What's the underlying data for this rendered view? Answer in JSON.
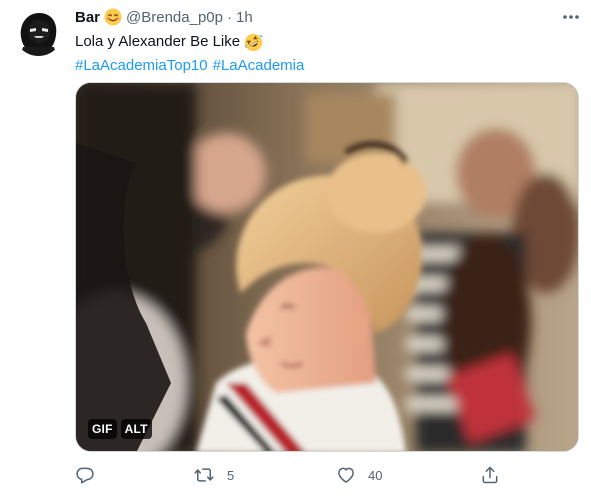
{
  "tweet": {
    "display_name": "Bar",
    "name_emoji": "smiling-face-with-smiling-eyes",
    "handle": "@Brenda_p0p",
    "separator": "·",
    "time": "1h",
    "text": "Lola y Alexander Be Like",
    "text_emoji": "rolling-on-the-floor-laughing",
    "hashtags": [
      "#LaAcademiaTop10",
      "#LaAcademia"
    ],
    "media": {
      "type_badge": "GIF",
      "alt_badge": "ALT"
    },
    "actions": {
      "reply_count": "",
      "retweet_count": "5",
      "like_count": "40",
      "share_count": ""
    }
  },
  "icons": {
    "more": "more-dots-icon",
    "reply": "reply-icon",
    "retweet": "retweet-icon",
    "like": "heart-icon",
    "share": "share-icon"
  },
  "colors": {
    "link": "#1d9bf0",
    "secondary_text": "#536471",
    "primary_text": "#0f1419",
    "border": "#cfd9de"
  }
}
